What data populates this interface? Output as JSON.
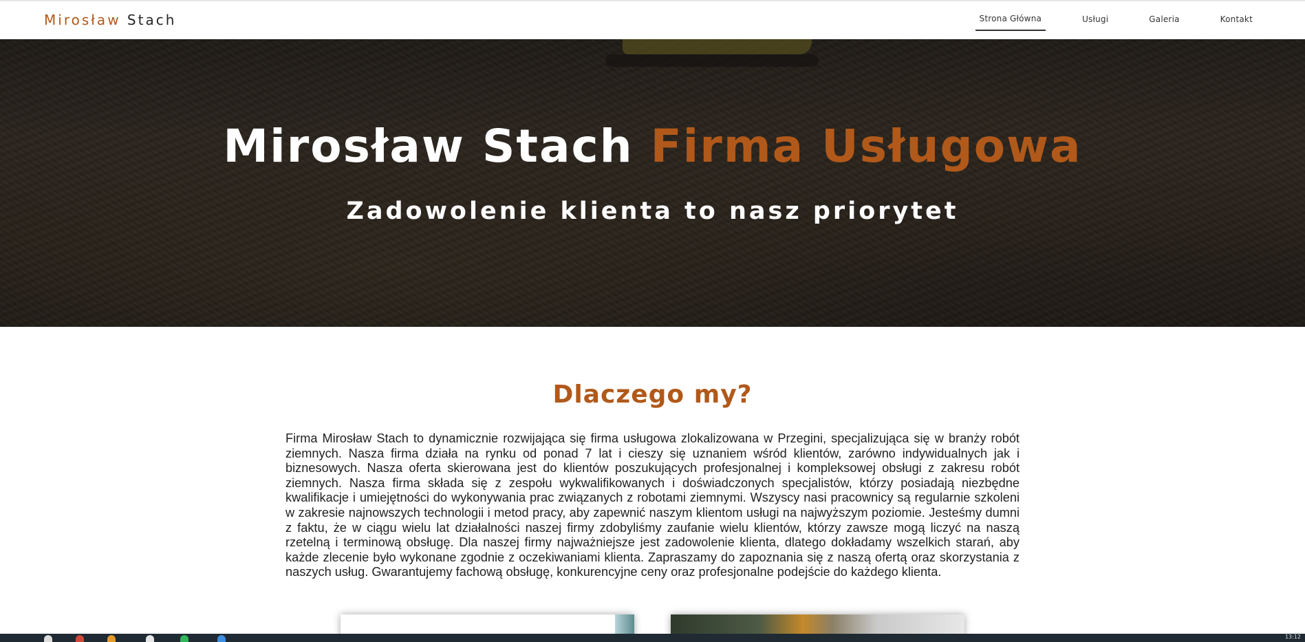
{
  "brand": {
    "first": "Mirosław",
    "last": "Stach"
  },
  "nav": {
    "items": [
      {
        "label": "Strona Główna",
        "active": true
      },
      {
        "label": "Usługi",
        "active": false
      },
      {
        "label": "Galeria",
        "active": false
      },
      {
        "label": "Kontakt",
        "active": false
      }
    ]
  },
  "hero": {
    "title_main": "Mirosław Stach",
    "title_accent": "Firma Usługowa",
    "subtitle": "Zadowolenie klienta to nasz priorytet"
  },
  "about": {
    "title": "Dlaczego my?",
    "body": "Firma Mirosław Stach to dynamicznie rozwijająca się firma usługowa zlokalizowana w Przegini, specjalizująca się w branży robót ziemnych. Nasza firma działa na rynku od ponad 7 lat i cieszy się uznaniem wśród klientów, zarówno indywidualnych jak i biznesowych. Nasza oferta skierowana jest do klientów poszukujących profesjonalnej i kompleksowej obsługi z zakresu robót ziemnych. Nasza firma składa się z zespołu wykwalifikowanych i doświadczonych specjalistów, którzy posiadają niezbędne kwalifikacje i umiejętności do wykonywania prac związanych z robotami ziemnymi. Wszyscy nasi pracownicy są regularnie szkoleni w zakresie najnowszych technologii i metod pracy, aby zapewnić naszym klientom usługi na najwyższym poziomie. Jesteśmy dumni z faktu, że w ciągu wielu lat działalności naszej firmy zdobyliśmy zaufanie wielu klientów, którzy zawsze mogą liczyć na naszą rzetelną i terminową obsługę. Dla naszej firmy najważniejsze jest zadowolenie klienta, dlatego dokładamy wszelkich starań, aby każde zlecenie było wykonane zgodnie z oczekiwaniami klienta. Zapraszamy do zapoznania się z naszą ofertą oraz skorzystania z naszych usług. Gwarantujemy fachową obsługę, konkurencyjne ceny oraz profesjonalne podejście do każdego klienta."
  },
  "colors": {
    "accent": "#b1591a",
    "text": "#222222",
    "hero_overlay": "#2b261f"
  },
  "taskbar": {
    "clock": "13:12"
  }
}
